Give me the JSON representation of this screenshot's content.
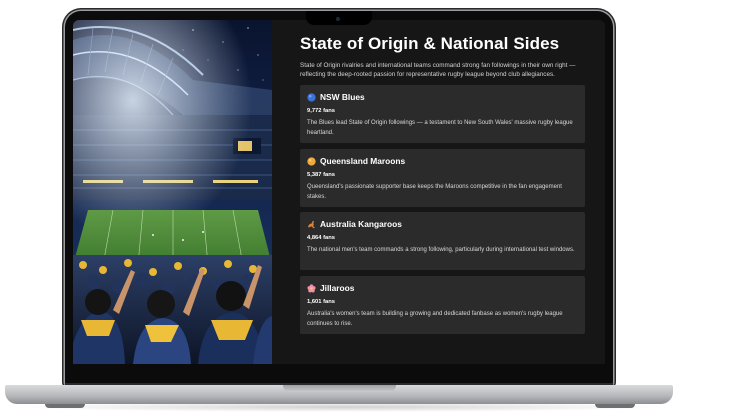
{
  "page": {
    "title": "State of Origin & National Sides",
    "intro": "State of Origin rivalries and international teams command strong fan followings in their own right — reflecting the deep-rooted passion for representative rugby league beyond club allegiances."
  },
  "teams": [
    {
      "icon": "blue-circle-icon",
      "icon_color": "#3b74d9",
      "name": "NSW Blues",
      "fans": "9,772 fans",
      "desc": "The Blues lead State of Origin followings — a testament to New South Wales' massive rugby league heartland."
    },
    {
      "icon": "orange-circle-icon",
      "icon_color": "#f2a93b",
      "name": "Queensland Maroons",
      "fans": "5,387 fans",
      "desc": "Queensland's passionate supporter base keeps the Maroons competitive in the fan engagement stakes."
    },
    {
      "icon": "kangaroo-icon",
      "icon_color": "#d9823b",
      "name": "Australia Kangaroos",
      "fans": "4,864 fans",
      "desc": "The national men's team commands a strong following, particularly during international test windows."
    },
    {
      "icon": "flower-icon",
      "icon_color": "#f08fb0",
      "name": "Jillaroos",
      "fans": "1,601 fans",
      "desc": "Australia's women's team is building a growing and dedicated fanbase as women's rugby league continues to rise."
    }
  ]
}
